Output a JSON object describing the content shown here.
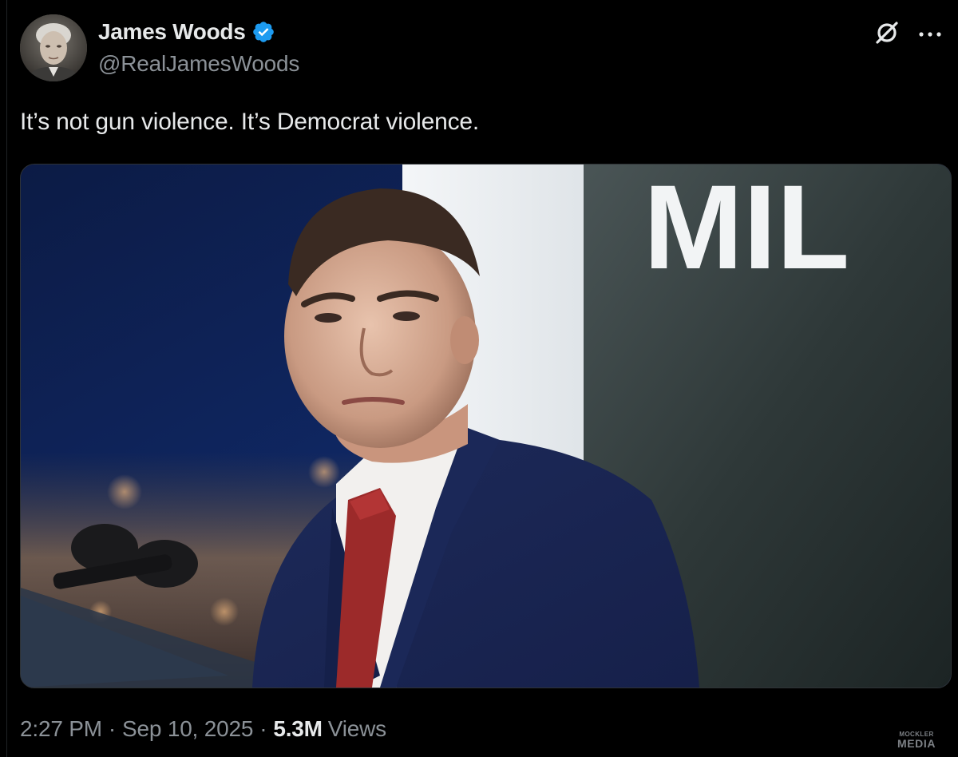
{
  "tweet": {
    "author": {
      "display_name": "James Woods",
      "handle": "@RealJamesWoods",
      "verified": true,
      "verified_color": "#1d9bf0",
      "avatar_icon": "profile-photo"
    },
    "header_icons": [
      "x-logo-icon",
      "more-icon"
    ],
    "text": "It’s not gun violence. It’s Democrat violence.",
    "media": {
      "type": "photo",
      "sign_text": "MIL"
    },
    "meta": {
      "time": "2:27 PM",
      "date": "Sep 10, 2025",
      "separator": "·",
      "views_count": "5.3M",
      "views_label": "Views"
    }
  },
  "watermark": {
    "top": "MOCKLER",
    "bottom": "MEDIA"
  },
  "colors": {
    "background": "#000000",
    "text_primary": "#e7e9ea",
    "text_secondary": "#8b9197"
  }
}
